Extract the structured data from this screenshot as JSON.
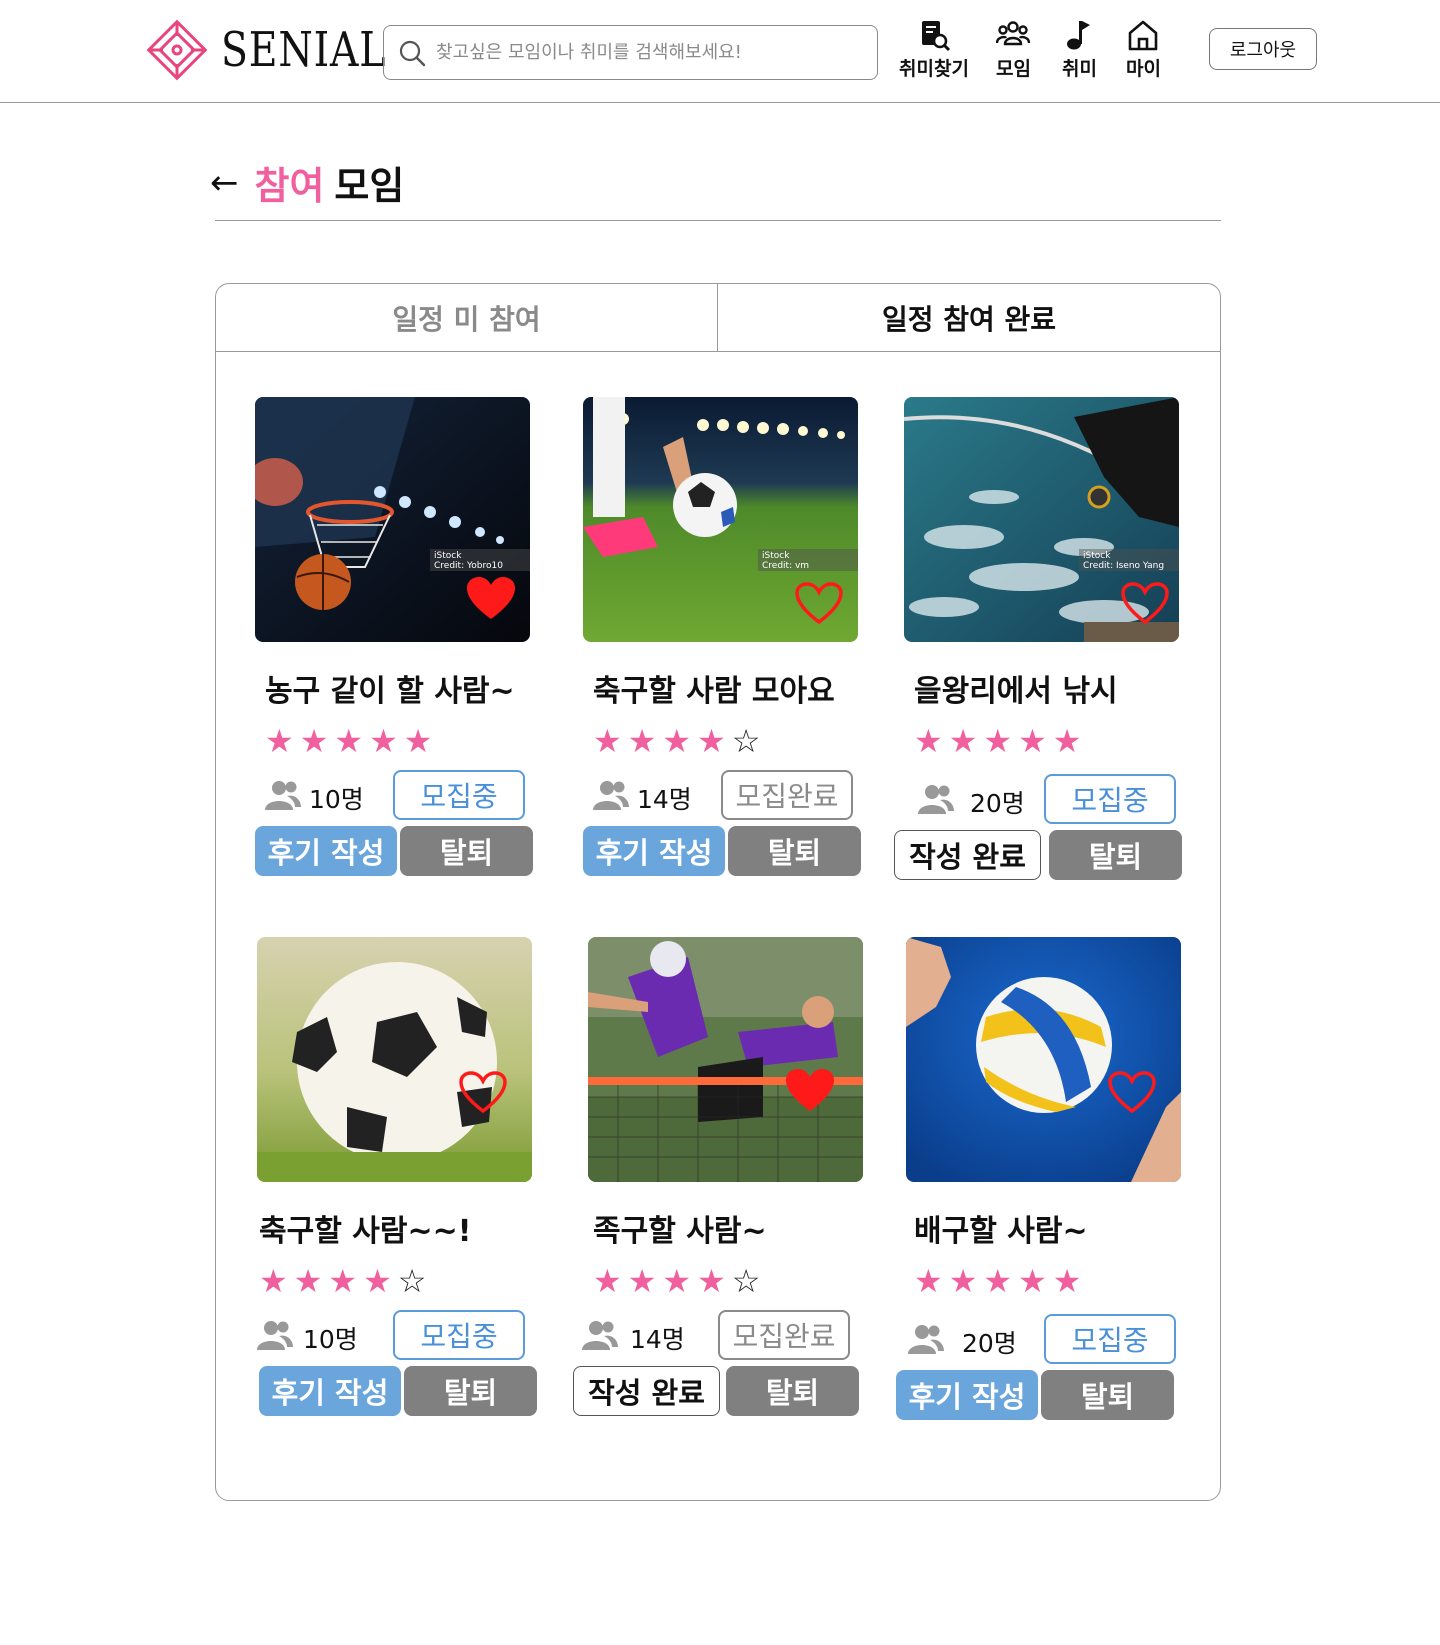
{
  "header": {
    "brand": "SENIAL",
    "search_placeholder": "찾고싶은 모임이나 취미를 검색해보세요!",
    "nav": [
      {
        "label": "취미찾기",
        "icon": "hobby-search-icon"
      },
      {
        "label": "모임",
        "icon": "group-icon"
      },
      {
        "label": "취미",
        "icon": "music-note-icon"
      },
      {
        "label": "마이",
        "icon": "home-icon"
      }
    ],
    "logout_label": "로그아웃"
  },
  "page": {
    "back_arrow": "←",
    "title_accent": "참여",
    "title_main": "모임"
  },
  "tabs": [
    {
      "label": "일정 미 참여",
      "active": false
    },
    {
      "label": "일정 참여 완료",
      "active": true
    }
  ],
  "colors": {
    "accent_pink": "#f0609e",
    "status_blue": "#4a90d9",
    "review_button": "#6aa6dc",
    "leave_button": "#808080",
    "heart_red": "#ff1a1a"
  },
  "cards": [
    {
      "title": "농구 같이 할 사람~",
      "rating": 5,
      "stars_filled": "★★★★★",
      "stars_empty": "",
      "members": "10명",
      "status": "모집중",
      "status_type": "open",
      "action": "후기 작성",
      "action_type": "review",
      "leave": "탈퇴",
      "liked": true,
      "photo": "basketball-hoop",
      "credit": "iStock\nCredit: Yobro10"
    },
    {
      "title": "축구할 사람 모아요",
      "rating": 4,
      "stars_filled": "★★★★",
      "stars_empty": "☆",
      "members": "14명",
      "status": "모집완료",
      "status_type": "closed",
      "action": "후기 작성",
      "action_type": "review",
      "leave": "탈퇴",
      "liked": false,
      "photo": "soccer-kickoff",
      "credit": "iStock\nCredit: vm"
    },
    {
      "title": "을왕리에서 낚시",
      "rating": 5,
      "stars_filled": "★★★★★",
      "stars_empty": "",
      "members": "20명",
      "status": "모집중",
      "status_type": "open",
      "action": "작성 완료",
      "action_type": "done",
      "leave": "탈퇴",
      "liked": false,
      "photo": "sea-fishing",
      "credit": "iStock\nCredit: Iseno Yang"
    },
    {
      "title": "축구할 사람~~!",
      "rating": 4,
      "stars_filled": "★★★★",
      "stars_empty": "☆",
      "members": "10명",
      "status": "모집중",
      "status_type": "open",
      "action": "후기 작성",
      "action_type": "review",
      "leave": "탈퇴",
      "liked": false,
      "photo": "soccer-ball-grass",
      "credit": ""
    },
    {
      "title": "족구할 사람~",
      "rating": 4,
      "stars_filled": "★★★★",
      "stars_empty": "☆",
      "members": "14명",
      "status": "모집완료",
      "status_type": "closed",
      "action": "작성 완료",
      "action_type": "done",
      "leave": "탈퇴",
      "liked": true,
      "photo": "jokgu-kick",
      "credit": ""
    },
    {
      "title": "배구할 사람~",
      "rating": 5,
      "stars_filled": "★★★★★",
      "stars_empty": "",
      "members": "20명",
      "status": "모집중",
      "status_type": "open",
      "action": "후기 작성",
      "action_type": "review",
      "leave": "탈퇴",
      "liked": false,
      "photo": "volleyball",
      "credit": ""
    }
  ]
}
